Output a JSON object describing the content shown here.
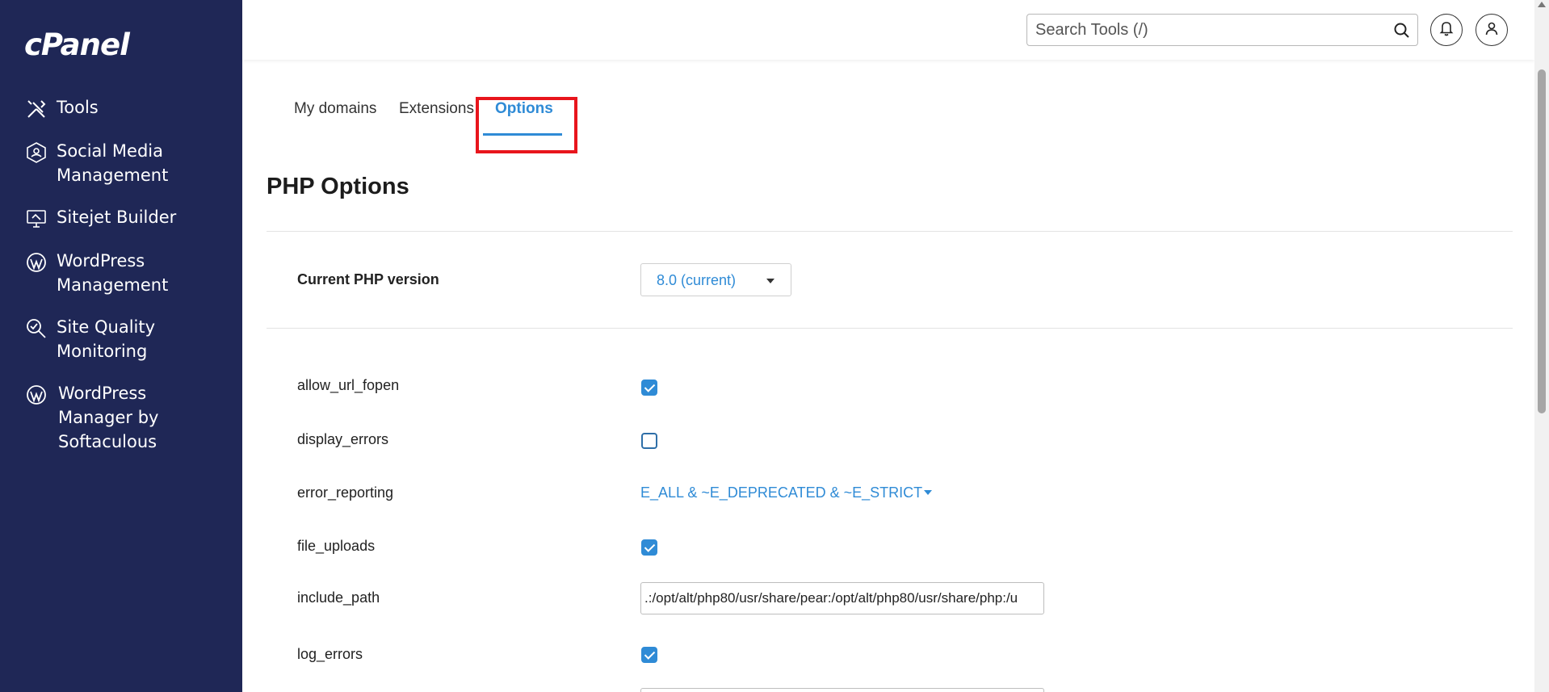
{
  "sidebar": {
    "logo": "cPanel",
    "items": [
      {
        "label": "Tools",
        "icon": "tools-icon"
      },
      {
        "label": "Social Media\nManagement",
        "icon": "social-media-icon"
      },
      {
        "label": "Sitejet Builder",
        "icon": "sitejet-icon"
      },
      {
        "label": "WordPress\nManagement",
        "icon": "wordpress-icon"
      },
      {
        "label": "Site Quality\nMonitoring",
        "icon": "site-quality-icon"
      },
      {
        "label": "WordPress\nManager by\nSoftaculous",
        "icon": "wordpress-icon"
      }
    ]
  },
  "header": {
    "search_placeholder": "Search Tools (/)",
    "icons": [
      "search-icon",
      "bell-icon",
      "user-icon"
    ]
  },
  "tabs": [
    {
      "label": "My domains"
    },
    {
      "label": "Extensions"
    },
    {
      "label": "Options",
      "active": true
    }
  ],
  "page": {
    "title": "PHP Options",
    "version_label": "Current PHP version",
    "version_value": "8.0 (current)"
  },
  "options": [
    {
      "name": "allow_url_fopen",
      "type": "checkbox",
      "checked": true
    },
    {
      "name": "display_errors",
      "type": "checkbox",
      "checked": false
    },
    {
      "name": "error_reporting",
      "type": "select",
      "value": "E_ALL & ~E_DEPRECATED & ~E_STRICT"
    },
    {
      "name": "file_uploads",
      "type": "checkbox",
      "checked": true
    },
    {
      "name": "include_path",
      "type": "text",
      "value": ".:/opt/alt/php80/usr/share/pear:/opt/alt/php80/usr/share/php:/u"
    },
    {
      "name": "log_errors",
      "type": "checkbox",
      "checked": true
    }
  ],
  "colors": {
    "sidebar_bg": "#1f2756",
    "accent": "#2f8bd6",
    "highlight": "#e8151c"
  }
}
